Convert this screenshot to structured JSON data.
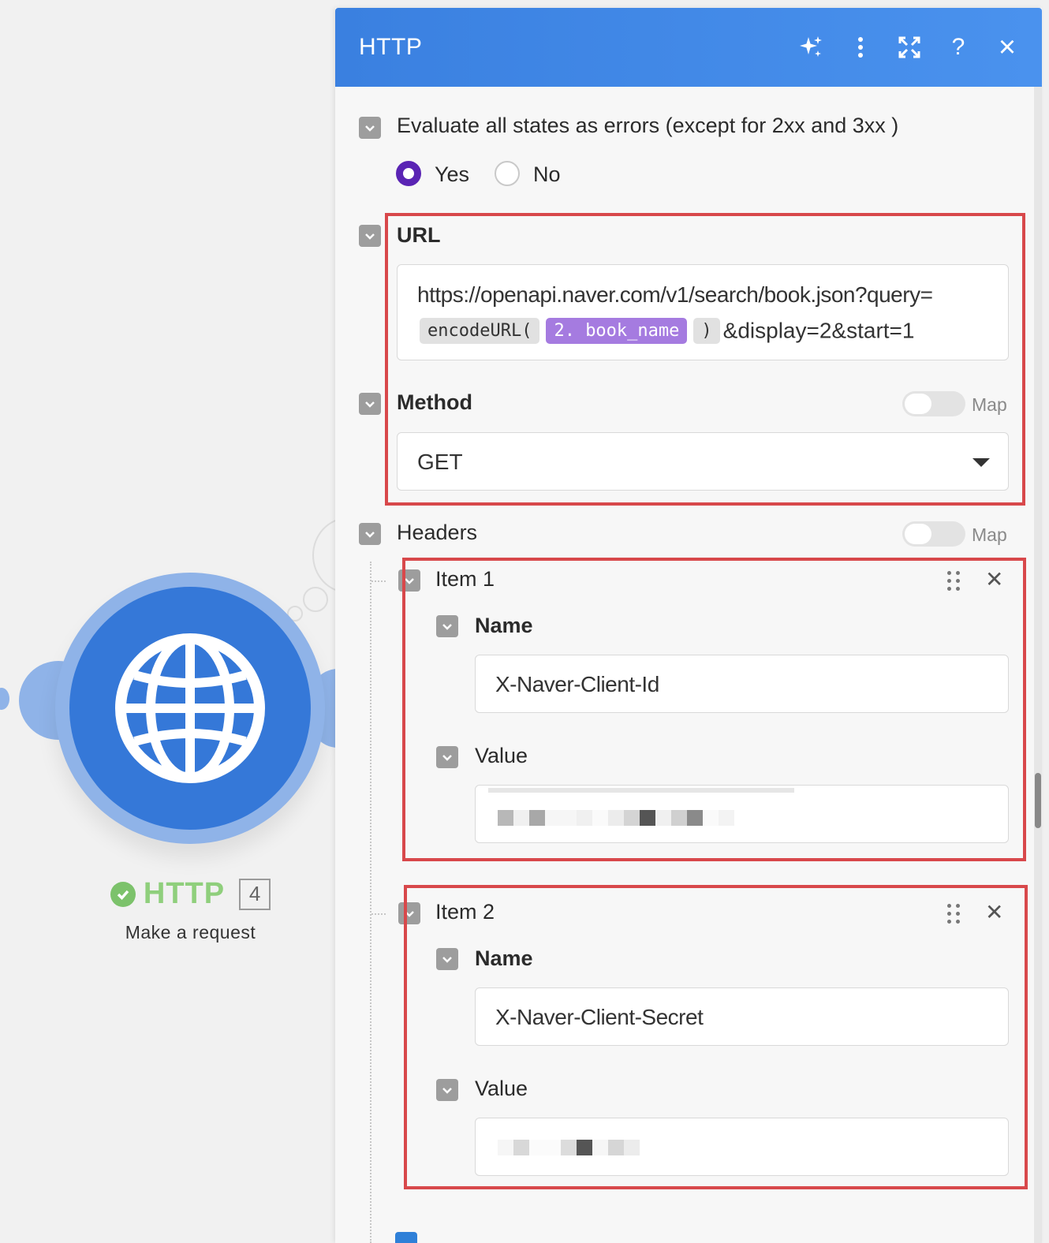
{
  "panel": {
    "title": "HTTP",
    "header_icons": [
      "sparkle-icon",
      "more-vertical-icon",
      "expand-icon",
      "help-icon",
      "close-icon"
    ],
    "help_glyph": "?",
    "close_glyph": "×"
  },
  "evaluate": {
    "label": "Evaluate all states as errors (except for 2xx and 3xx )",
    "options": [
      {
        "label": "Yes",
        "selected": true
      },
      {
        "label": "No",
        "selected": false
      }
    ]
  },
  "url": {
    "label": "URL",
    "line1": "https://openapi.naver.com/v1/search/book.json?query=",
    "fn_open": "encodeURL(",
    "variable": "2. book_name",
    "fn_close": ")",
    "suffix": "&display=2&start=1"
  },
  "method": {
    "label": "Method",
    "map_label": "Map",
    "value": "GET"
  },
  "headers": {
    "label": "Headers",
    "map_label": "Map",
    "items": [
      {
        "title": "Item 1",
        "name_label": "Name",
        "name_value": "X-Naver-Client-Id",
        "value_label": "Value"
      },
      {
        "title": "Item 2",
        "name_label": "Name",
        "name_value": "X-Naver-Client-Secret",
        "value_label": "Value"
      }
    ]
  },
  "module": {
    "name": "HTTP",
    "number": "4",
    "subtitle": "Make a request"
  },
  "colors": {
    "header": "#3a83e4",
    "radio_selected": "#5a24b4",
    "variable_pill": "#a57be0",
    "highlight": "#d8484b",
    "module_blue": "#3578d8",
    "success_green": "#7cc26b"
  }
}
